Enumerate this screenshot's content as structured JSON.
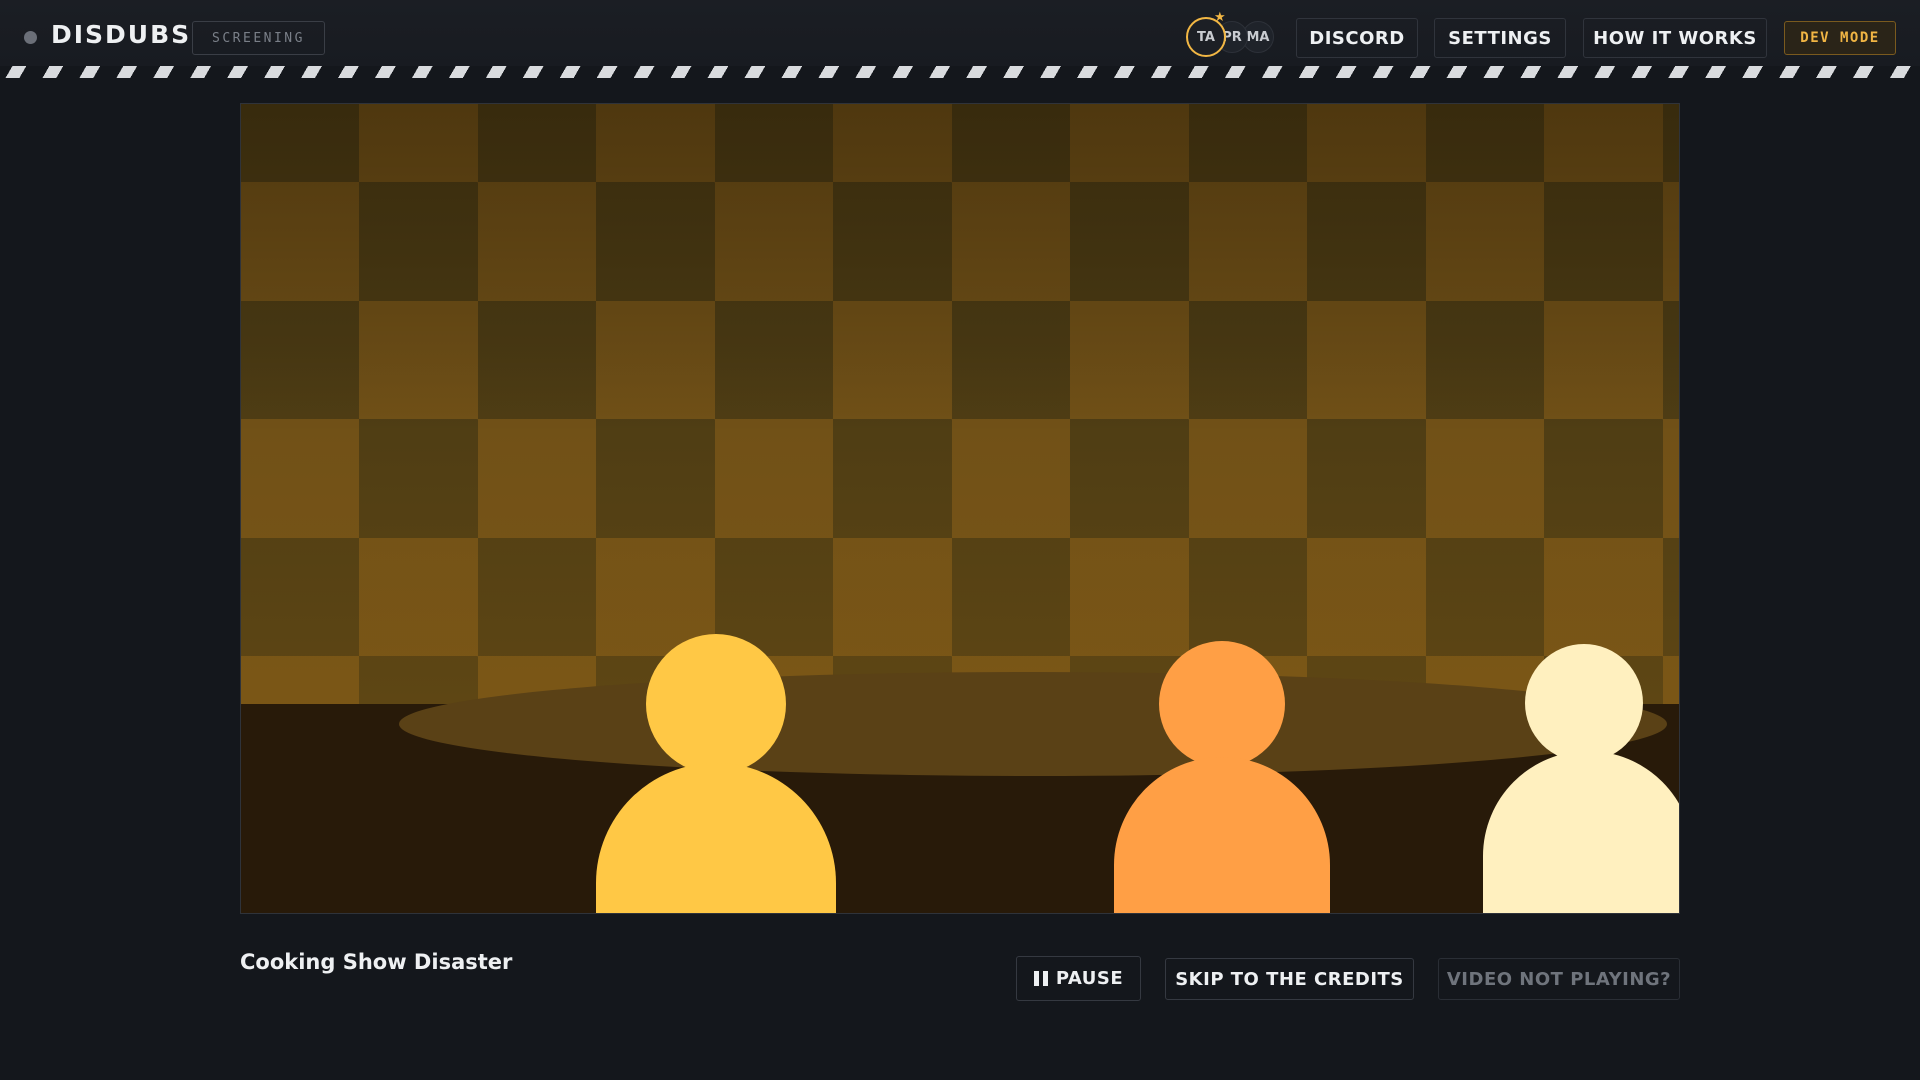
{
  "header": {
    "logo": "DISDUBS",
    "mode_badge": "SCREENING",
    "avatars": [
      "TA",
      "PR",
      "MA"
    ],
    "host_star": "★",
    "nav": {
      "discord": "DISCORD",
      "settings": "SETTINGS",
      "how_it_works": "HOW IT WORKS",
      "dev_mode": "DEV MODE"
    }
  },
  "video": {
    "title": "Cooking Show Disaster",
    "scene_colors": {
      "checker_dark": "#4b3b14",
      "checker_light": "#6e4f17",
      "floor": "#281a09",
      "table": "#5a4116",
      "person_1": "#ffc845",
      "person_2": "#ff9f45",
      "person_3": "#fff0bf"
    }
  },
  "controls": {
    "pause": "PAUSE",
    "skip": "SKIP TO THE CREDITS",
    "not_playing": "VIDEO NOT PLAYING?"
  },
  "colors": {
    "accent": "#f2b744",
    "background": "#14171c"
  }
}
